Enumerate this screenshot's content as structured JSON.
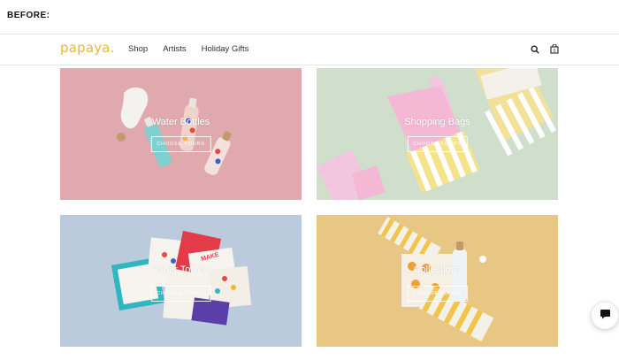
{
  "caption": "BEFORE:",
  "brand": {
    "logo": "papaya."
  },
  "nav": {
    "items": [
      "Shop",
      "Artists",
      "Holiday Gifts"
    ]
  },
  "icons": {
    "search": "search-icon",
    "cart": "bag-icon",
    "chat": "chat-icon"
  },
  "tiles": [
    {
      "title": "Water Bottles",
      "button": "CHOOSE YOURS"
    },
    {
      "title": "Shopping Bags",
      "button": "CHOOSE YOURS"
    },
    {
      "title": "Paper Towels",
      "button": "CHOOSE YOURS"
    },
    {
      "title": "Collections",
      "button": "CHOOSE YOURS"
    }
  ],
  "colors": {
    "brand": "#e7b93a",
    "tile1": "#dfa9ad",
    "tile2": "#cfdfcc",
    "tile3": "#bccadd",
    "tile4": "#e8c785"
  }
}
